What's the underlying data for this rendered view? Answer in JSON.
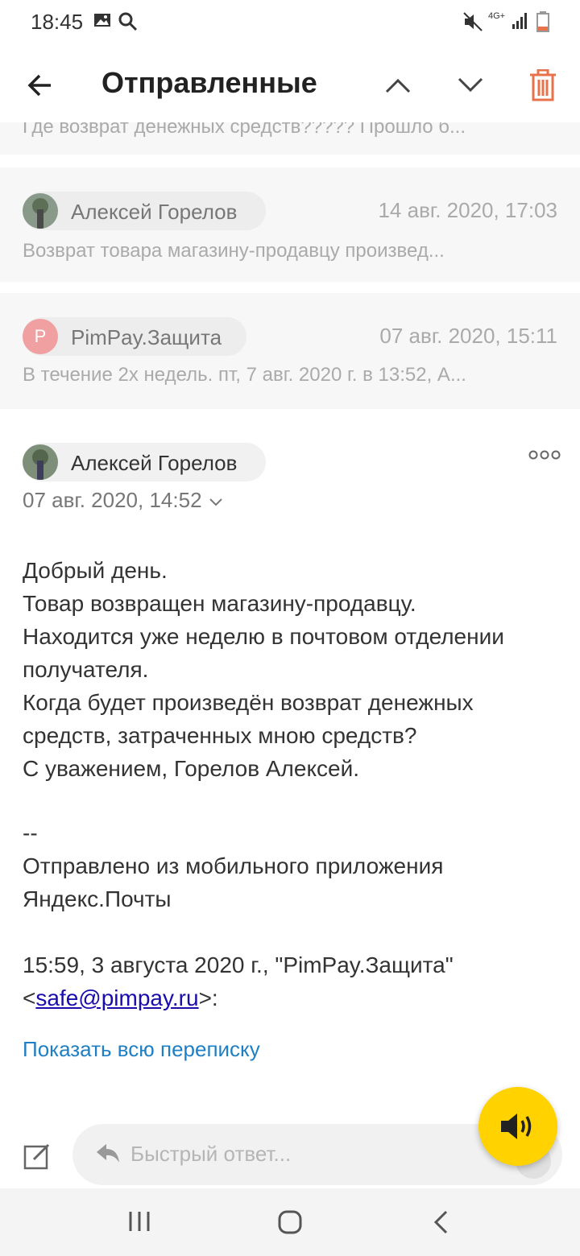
{
  "status": {
    "time": "18:45",
    "network": "4G+"
  },
  "header": {
    "title": "Отправленные"
  },
  "icons": {
    "back": "back-arrow-icon",
    "up": "chevron-up-icon",
    "down": "chevron-down-icon",
    "delete": "trash-icon",
    "more": "more-icon",
    "compose": "compose-icon",
    "reply": "reply-icon",
    "speaker": "speaker-icon"
  },
  "colors": {
    "delete": "#e8734a",
    "fab": "#ffd200",
    "link": "#1f7fc4",
    "avatar_p": "#f0a0a0"
  },
  "messages": [
    {
      "snippet": "Где возврат денежных средств????? Прошло б..."
    },
    {
      "sender": "Алексей Горелов",
      "date": "14 авг. 2020, 17:03",
      "snippet": "Возврат товара магазину-продавцу произвед..."
    },
    {
      "avatar_letter": "P",
      "sender": "PimPay.Защита",
      "date": "07 авг. 2020, 15:11",
      "snippet": "В течение 2х недель. пт, 7 авг. 2020 г. в 13:52, А..."
    }
  ],
  "open_message": {
    "sender": "Алексей Горелов",
    "date": "07 авг. 2020, 14:52",
    "body": "Добрый день.\nТовар возвращен магазину-продавцу.\nНаходится уже неделю в почтовом отделении получателя.\nКогда будет произведён возврат денежных средств, затраченных мною средств?\nС уважением, Горелов Алексей.",
    "signature_sep": "--",
    "signature": "Отправлено из мобильного приложения Яндекс.Почты",
    "quote_header": "15:59, 3 августа 2020 г., \"PimPay.Защита\"",
    "quote_lt": "<",
    "quote_email": "safe@pimpay.ru",
    "quote_gt": ">:",
    "show_all": "Показать всю переписку"
  },
  "reply": {
    "placeholder": "Быстрый ответ..."
  }
}
